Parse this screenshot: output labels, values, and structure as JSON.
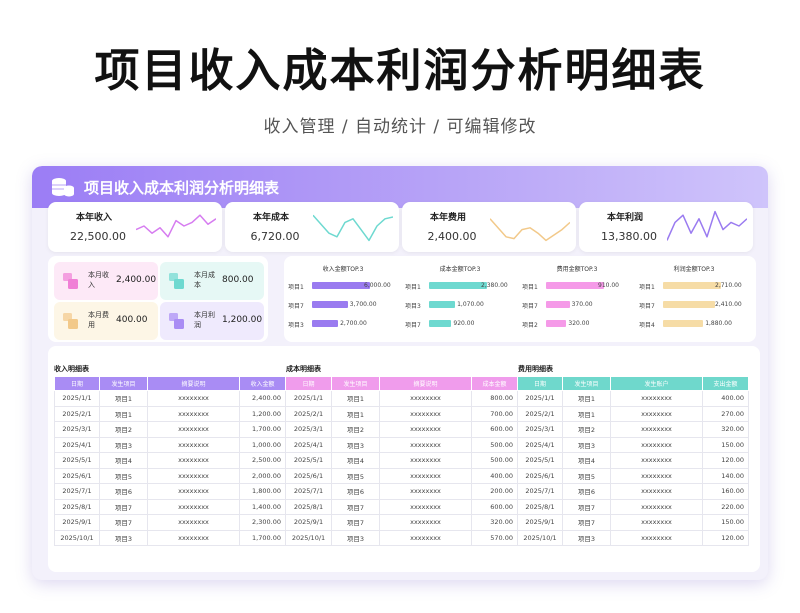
{
  "page": {
    "title": "项目收入成本利润分析明细表",
    "subtitle": "收入管理 / 自动统计 / 可编辑修改"
  },
  "sheet": {
    "banner_title": "项目收入成本利润分析明细表",
    "kpis": [
      {
        "label": "本年收入",
        "value": "22,500.00",
        "color": "#d67cf0"
      },
      {
        "label": "本年成本",
        "value": "6,720.00",
        "color": "#6ed9d0"
      },
      {
        "label": "本年费用",
        "value": "2,400.00",
        "color": "#f2c98a"
      },
      {
        "label": "本年利润",
        "value": "13,380.00",
        "color": "#9a7bf0"
      }
    ],
    "monthly": [
      {
        "label": "本月收入",
        "value": "2,400.00",
        "bg": "#fde9f7",
        "icon": "#f07fd6"
      },
      {
        "label": "本月成本",
        "value": "800.00",
        "bg": "#e6f8f5",
        "icon": "#6ed9d0"
      },
      {
        "label": "本月费用",
        "value": "400.00",
        "bg": "#fdf6e6",
        "icon": "#f2c98a"
      },
      {
        "label": "本月利润",
        "value": "1,200.00",
        "bg": "#efeafd",
        "icon": "#a98cf4"
      }
    ],
    "top_charts": [
      {
        "title": "收入金额TOP.3",
        "color": "#9a7bf0",
        "max": 6000,
        "items": [
          {
            "name": "项目1",
            "value": 6000,
            "label": "6,000.00"
          },
          {
            "name": "项目7",
            "value": 3700,
            "label": "3,700.00"
          },
          {
            "name": "项目3",
            "value": 2700,
            "label": "2,700.00"
          }
        ]
      },
      {
        "title": "成本金额TOP.3",
        "color": "#6ed9d0",
        "max": 2380,
        "items": [
          {
            "name": "项目1",
            "value": 2380,
            "label": "2,380.00"
          },
          {
            "name": "项目3",
            "value": 1070,
            "label": "1,070.00"
          },
          {
            "name": "项目7",
            "value": 920,
            "label": "920.00"
          }
        ]
      },
      {
        "title": "费用金额TOP.3",
        "color": "#f59ae8",
        "max": 910,
        "items": [
          {
            "name": "项目1",
            "value": 910,
            "label": "910.00"
          },
          {
            "name": "项目7",
            "value": 370,
            "label": "370.00"
          },
          {
            "name": "项目2",
            "value": 320,
            "label": "320.00"
          }
        ]
      },
      {
        "title": "利润金额TOP.3",
        "color": "#f6dca6",
        "max": 2710,
        "items": [
          {
            "name": "项目1",
            "value": 2710,
            "label": "2,710.00"
          },
          {
            "name": "项目7",
            "value": 2410,
            "label": "2,410.00"
          },
          {
            "name": "项目4",
            "value": 1880,
            "label": "1,880.00"
          }
        ]
      }
    ],
    "income_table": {
      "title": "收入明细表",
      "headers": [
        "日期",
        "发生项目",
        "摘要说明",
        "收入金额"
      ],
      "rows": [
        [
          "2025/1/1",
          "项目1",
          "xxxxxxxx",
          "2,400.00"
        ],
        [
          "2025/2/1",
          "项目1",
          "xxxxxxxx",
          "1,200.00"
        ],
        [
          "2025/3/1",
          "项目2",
          "xxxxxxxx",
          "1,700.00"
        ],
        [
          "2025/4/1",
          "项目3",
          "xxxxxxxx",
          "1,000.00"
        ],
        [
          "2025/5/1",
          "项目4",
          "xxxxxxxx",
          "2,500.00"
        ],
        [
          "2025/6/1",
          "项目5",
          "xxxxxxxx",
          "2,000.00"
        ],
        [
          "2025/7/1",
          "项目6",
          "xxxxxxxx",
          "1,800.00"
        ],
        [
          "2025/8/1",
          "项目7",
          "xxxxxxxx",
          "1,400.00"
        ],
        [
          "2025/9/1",
          "项目7",
          "xxxxxxxx",
          "2,300.00"
        ],
        [
          "2025/10/1",
          "项目3",
          "xxxxxxxx",
          "1,700.00"
        ]
      ]
    },
    "cost_table": {
      "title": "成本明细表",
      "headers": [
        "日期",
        "发生项目",
        "摘要说明",
        "成本金额"
      ],
      "rows": [
        [
          "2025/1/1",
          "项目1",
          "xxxxxxxx",
          "800.00"
        ],
        [
          "2025/2/1",
          "项目1",
          "xxxxxxxx",
          "700.00"
        ],
        [
          "2025/3/1",
          "项目2",
          "xxxxxxxx",
          "600.00"
        ],
        [
          "2025/4/1",
          "项目3",
          "xxxxxxxx",
          "500.00"
        ],
        [
          "2025/5/1",
          "项目4",
          "xxxxxxxx",
          "500.00"
        ],
        [
          "2025/6/1",
          "项目5",
          "xxxxxxxx",
          "400.00"
        ],
        [
          "2025/7/1",
          "项目6",
          "xxxxxxxx",
          "200.00"
        ],
        [
          "2025/8/1",
          "项目7",
          "xxxxxxxx",
          "600.00"
        ],
        [
          "2025/9/1",
          "项目7",
          "xxxxxxxx",
          "320.00"
        ],
        [
          "2025/10/1",
          "项目3",
          "xxxxxxxx",
          "570.00"
        ]
      ]
    },
    "fee_table": {
      "title": "费用明细表",
      "headers": [
        "日期",
        "发生项目",
        "发生账户",
        "支出金额"
      ],
      "rows": [
        [
          "2025/1/1",
          "项目1",
          "xxxxxxxx",
          "400.00"
        ],
        [
          "2025/2/1",
          "项目1",
          "xxxxxxxx",
          "270.00"
        ],
        [
          "2025/3/1",
          "项目2",
          "xxxxxxxx",
          "320.00"
        ],
        [
          "2025/4/1",
          "项目3",
          "xxxxxxxx",
          "150.00"
        ],
        [
          "2025/5/1",
          "项目4",
          "xxxxxxxx",
          "120.00"
        ],
        [
          "2025/6/1",
          "项目5",
          "xxxxxxxx",
          "140.00"
        ],
        [
          "2025/7/1",
          "项目6",
          "xxxxxxxx",
          "160.00"
        ],
        [
          "2025/8/1",
          "项目7",
          "xxxxxxxx",
          "220.00"
        ],
        [
          "2025/9/1",
          "项目7",
          "xxxxxxxx",
          "150.00"
        ],
        [
          "2025/10/1",
          "项目3",
          "xxxxxxxx",
          "120.00"
        ]
      ]
    }
  }
}
